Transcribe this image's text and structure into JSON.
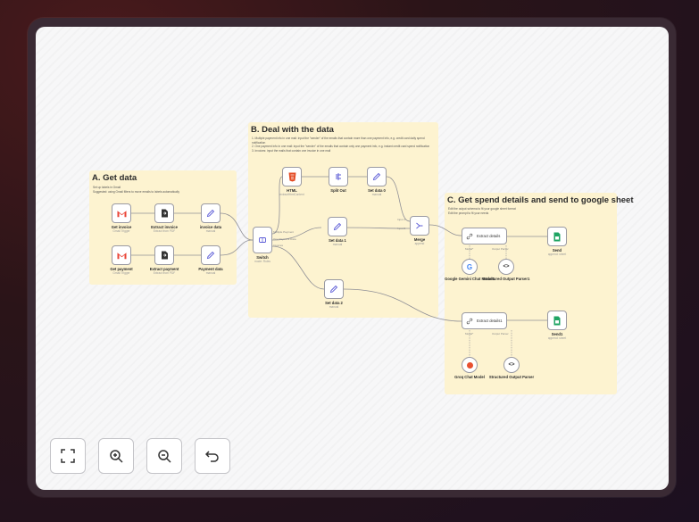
{
  "sections": {
    "a": {
      "title": "A. Get data",
      "notes": [
        "Set up labels in Gmail",
        "Suggested: using Gmail filters to move emails to labels automatically"
      ]
    },
    "b": {
      "title": "B. Deal with the data",
      "notes": [
        "1. Multiple payment info in one mail: input the \"sender\" of the emails that contain more than one payment info, e.g. credit card daily spend notification",
        "2. One payment info in one mail: input the \"sender\" of the emails that contain only one payment info, e.g. instant credit card spend notification",
        "3. Invoices: input the mails that contain one invoice in one mail"
      ]
    },
    "c": {
      "title": "C. Get spend details and send to google sheet",
      "notes": [
        "Edit the output schema to fit your google sheet format",
        "Edit the prompt to fit your needs"
      ]
    }
  },
  "nodes": {
    "get_invoice": {
      "label": "Get invoice",
      "sub": "Gmail Trigger",
      "icon": "gmail-icon"
    },
    "extract_invoice": {
      "label": "Extract invoice",
      "sub": "Extract from PDF",
      "icon": "extract-from-file-icon"
    },
    "invoice_data": {
      "label": "invoice data",
      "sub": "manual",
      "icon": "pencil-icon"
    },
    "get_payment": {
      "label": "Get payment",
      "sub": "Gmail Trigger",
      "icon": "gmail-icon"
    },
    "extract_payment": {
      "label": "Extract payment",
      "sub": "Extract from PDF",
      "icon": "extract-from-file-icon"
    },
    "payment_data": {
      "label": "Payment data",
      "sub": "manual",
      "icon": "pencil-icon"
    },
    "switch": {
      "label": "Switch",
      "sub": "mode: Rules",
      "icon": "switch-icon",
      "outputs": [
        "Multiple Payment",
        "One Payment Data",
        "Invoices"
      ]
    },
    "html": {
      "label": "HTML",
      "sub": "extractHtmlContent",
      "icon": "html-icon"
    },
    "split_out": {
      "label": "Split Out",
      "sub": "",
      "icon": "split-out-icon"
    },
    "set_data_0": {
      "label": "Set data 0",
      "sub": "manual",
      "icon": "pencil-icon"
    },
    "set_data_1": {
      "label": "Set data 1",
      "sub": "manual",
      "icon": "pencil-icon"
    },
    "set_data_2": {
      "label": "Set data 2",
      "sub": "manual",
      "icon": "pencil-icon"
    },
    "merge": {
      "label": "Merge",
      "sub": "append",
      "icon": "merge-icon",
      "inputs": [
        "Input 1",
        "Input 2"
      ]
    },
    "extract_details": {
      "label": "Extract details",
      "icon": "link-icon",
      "ports": [
        "Model*",
        "Output Parser"
      ]
    },
    "send": {
      "label": "Send",
      "sub": "append: sheet",
      "icon": "google-sheets-icon"
    },
    "gemini": {
      "label": "Google Gemini Chat Model1",
      "icon": "google-icon"
    },
    "parser1": {
      "label": "Structured Output Parser1",
      "icon": "code-icon"
    },
    "extract_details1": {
      "label": "Extract details1",
      "icon": "link-icon",
      "ports": [
        "Model*",
        "Output Parser"
      ]
    },
    "send1": {
      "label": "Send1",
      "sub": "append: sheet",
      "icon": "google-sheets-icon"
    },
    "groq": {
      "label": "Groq Chat Model",
      "icon": "groq-icon"
    },
    "parser2": {
      "label": "Structured Output Parser",
      "icon": "code-icon"
    }
  },
  "toolbar": [
    {
      "name": "fit-view-button",
      "icon": "fit-view-icon"
    },
    {
      "name": "zoom-in-button",
      "icon": "zoom-in-icon"
    },
    {
      "name": "zoom-out-button",
      "icon": "zoom-out-icon"
    },
    {
      "name": "reset-zoom-button",
      "icon": "undo-icon"
    }
  ],
  "colors": {
    "sticky": "#fdf3d0",
    "accent_purple": "#5b5bd6",
    "gmail_red": "#ea4335",
    "sheets_green": "#1fa463",
    "wire": "#8f8f96"
  }
}
